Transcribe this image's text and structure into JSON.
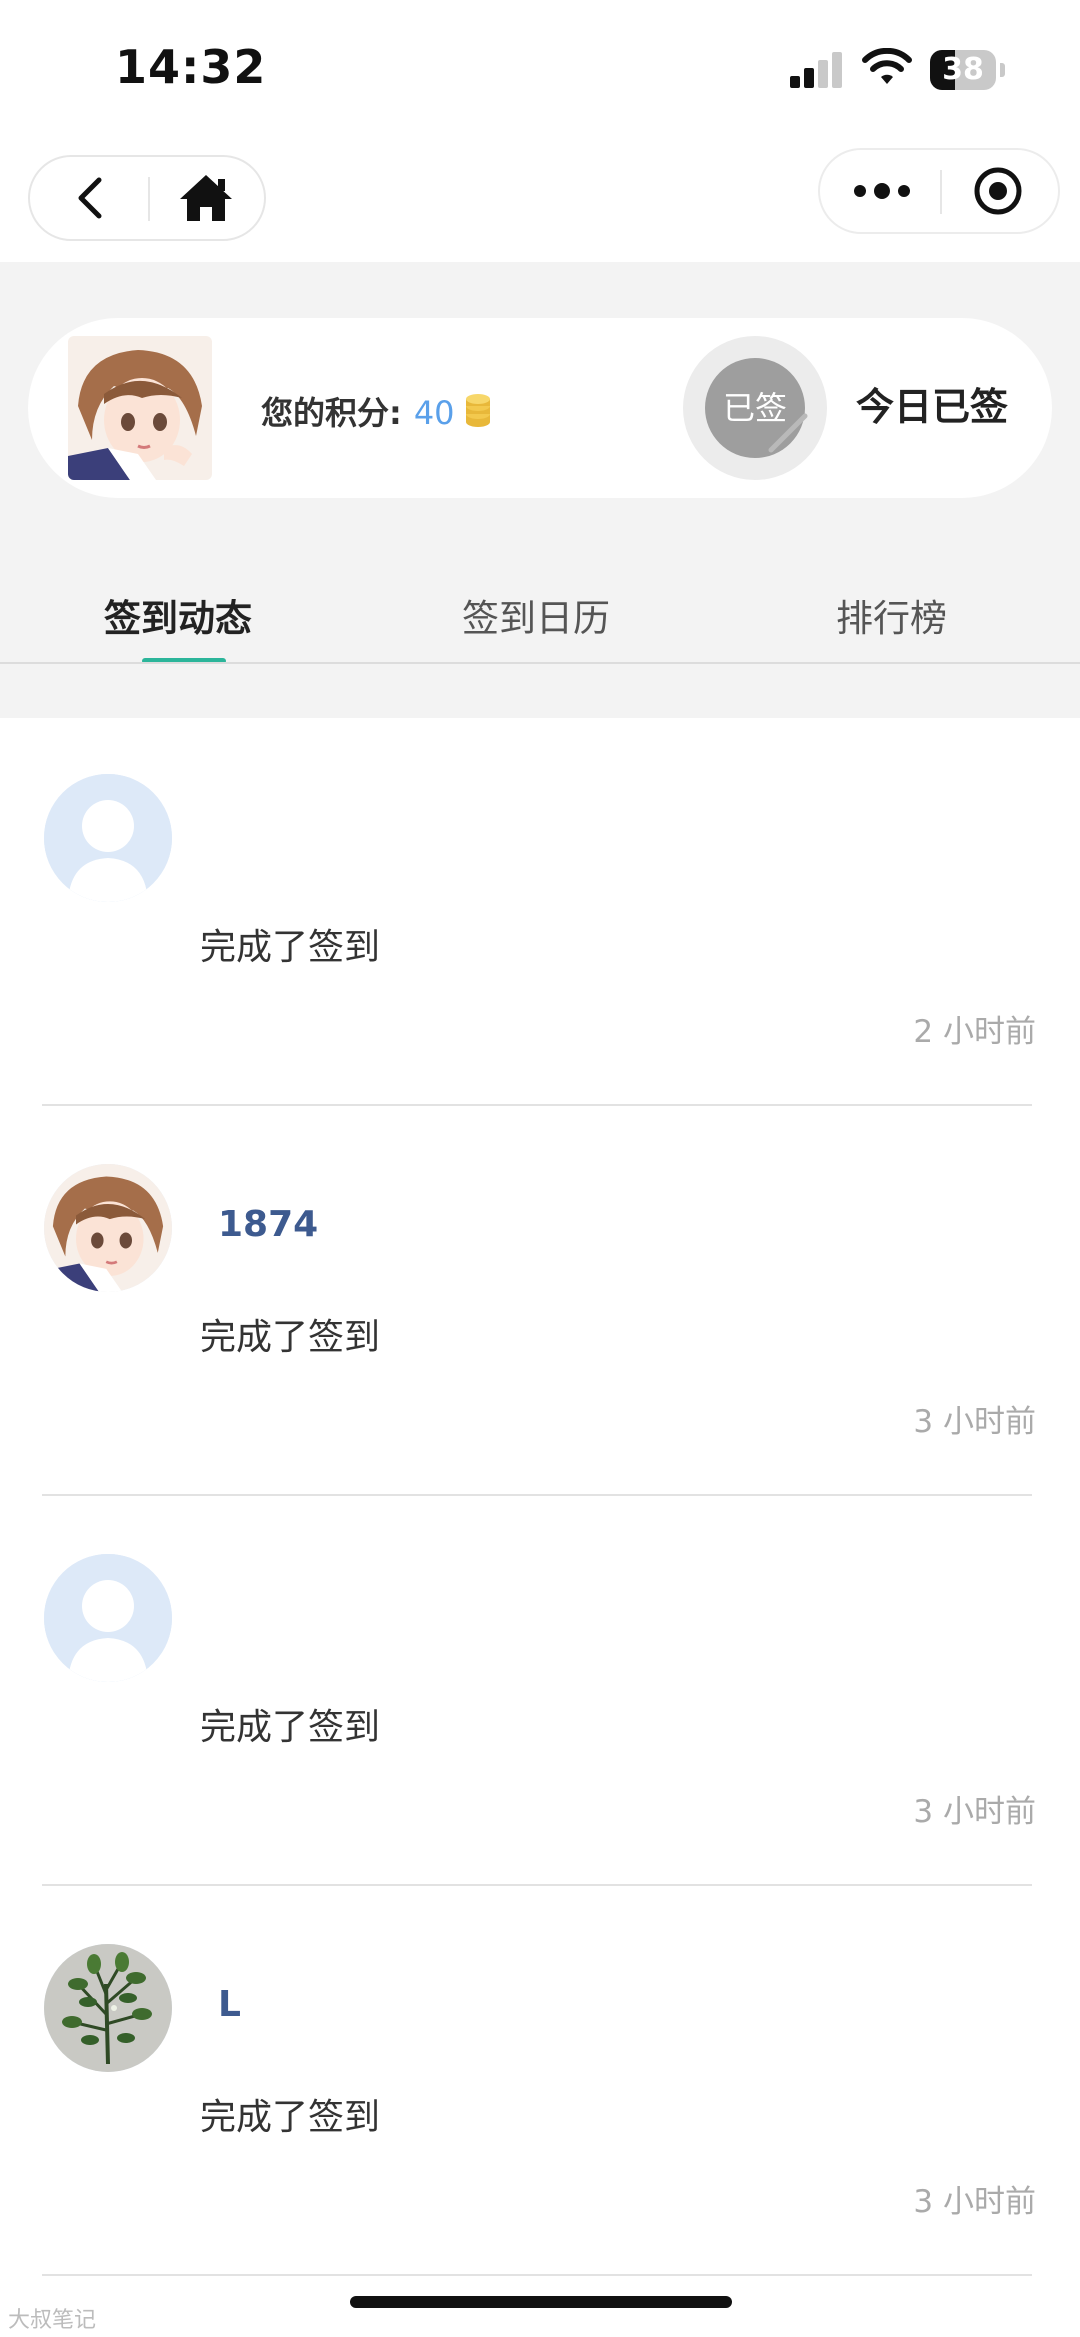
{
  "status_bar": {
    "time": "14:32",
    "battery": "38",
    "battery_level": 0.38
  },
  "nav": {
    "back_icon": "chevron-left-icon",
    "home_icon": "home-icon",
    "more_icon": "more-dots-icon",
    "close_icon": "target-circle-icon"
  },
  "user_card": {
    "points_label": "您的积分:",
    "points_value": "40",
    "stamp_label": "已签",
    "signed_status": "今日已签"
  },
  "tabs": [
    {
      "label": "签到动态",
      "active": true
    },
    {
      "label": "签到日历",
      "active": false
    },
    {
      "label": "排行榜",
      "active": false
    }
  ],
  "feed": [
    {
      "name": "",
      "avatar": "default",
      "text": "完成了签到",
      "time": "2 小时前"
    },
    {
      "name": "1874",
      "avatar": "anime-girl",
      "text": "完成了签到",
      "time": "3 小时前"
    },
    {
      "name": "",
      "avatar": "default",
      "text": "完成了签到",
      "time": "3 小时前"
    },
    {
      "name": "L",
      "avatar": "plant",
      "text": "完成了签到",
      "time": "3 小时前"
    }
  ],
  "watermark": "大叔笔记",
  "colors": {
    "accent": "#2bb59a",
    "points": "#5aa0ea",
    "username": "#3d5a8f"
  }
}
